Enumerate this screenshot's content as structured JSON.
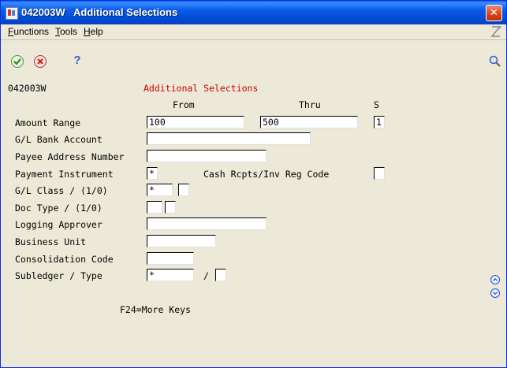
{
  "window": {
    "title": "042003W   Additional Selections",
    "colors": {
      "title_bar": "#0a5ae6",
      "label_red": "#cc0000"
    }
  },
  "menu": {
    "items": [
      {
        "label": "Functions",
        "underline": "F"
      },
      {
        "label": "Tools",
        "underline": "T"
      },
      {
        "label": "Help",
        "underline": "H"
      }
    ]
  },
  "toolbar": {
    "ok_icon": "check-icon",
    "cancel_icon": "cancel-icon",
    "help_icon": "question-icon",
    "search_icon": "magnifier-icon",
    "help_glyph": "?"
  },
  "form": {
    "form_id": "042003W",
    "heading": "Additional Selections",
    "col_from": "From",
    "col_thru": "Thru",
    "col_s": "S",
    "labels": {
      "amount_range": "Amount Range",
      "gl_bank_account": "G/L Bank Account",
      "payee_address_number": "Payee Address Number",
      "payment_instrument": "Payment Instrument",
      "cash_rcpts_code": "Cash Rcpts/Inv Reg Code",
      "gl_class": "G/L Class / (1/0)",
      "doc_type": "Doc Type / (1/0)",
      "logging_approver": "Logging Approver",
      "business_unit": "Business Unit",
      "consolidation_code": "Consolidation Code",
      "subledger_type": "Subledger / Type",
      "slash": "/"
    },
    "values": {
      "amount_from": "100",
      "amount_thru": "500",
      "amount_s": "1",
      "gl_bank_account": "",
      "payee_address_number": "",
      "payment_instrument": "*",
      "cash_rcpts_code": "",
      "gl_class": "*",
      "gl_class_flag": "",
      "doc_type": "",
      "doc_type_flag": "",
      "logging_approver": "",
      "business_unit": "",
      "consolidation_code": "",
      "subledger": "*",
      "subledger_type": ""
    },
    "footer": "F24=More Keys"
  }
}
